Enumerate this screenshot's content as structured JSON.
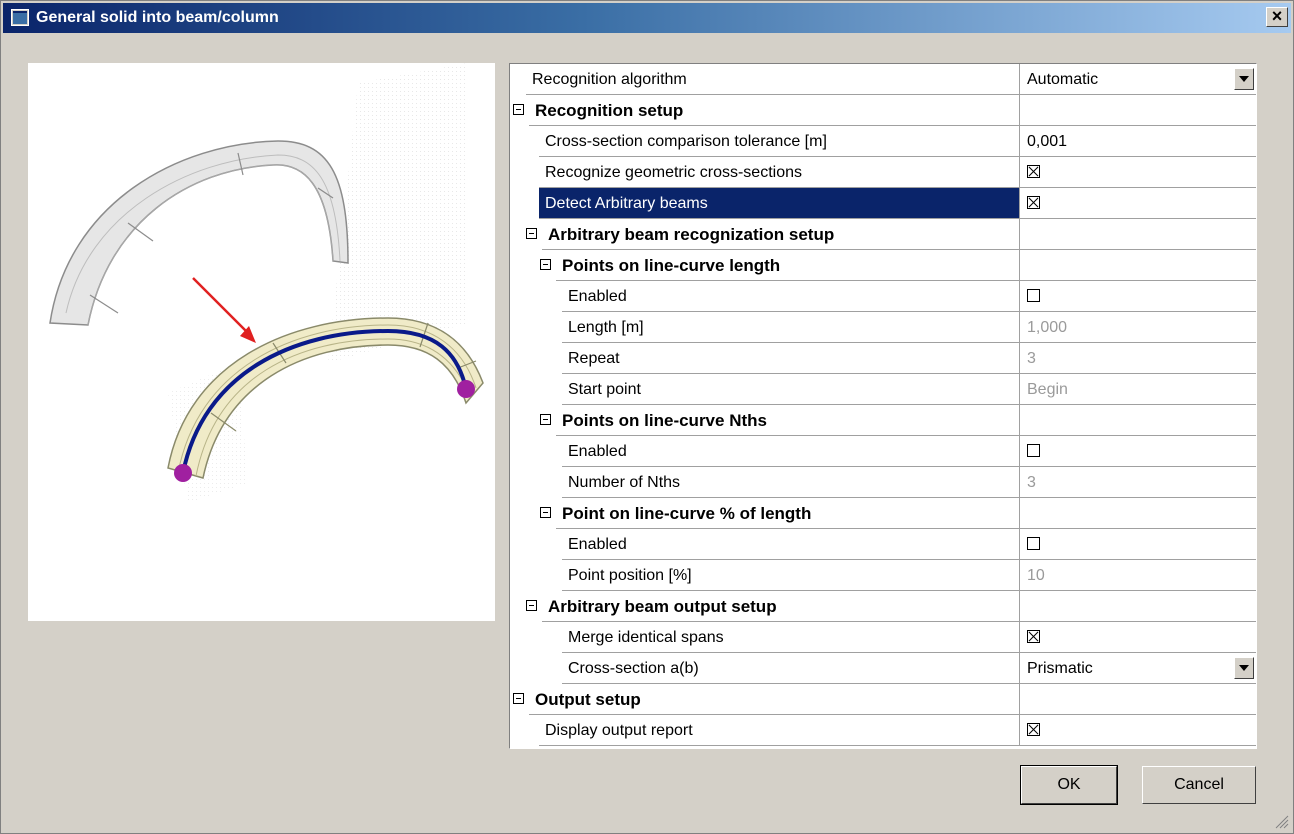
{
  "window": {
    "title": "General solid into beam/column",
    "close_label": "×"
  },
  "grid": {
    "rows": [
      {
        "name": "Recognition algorithm",
        "level": 0,
        "type": "dropdown",
        "value": "Automatic"
      },
      {
        "name": "Recognition setup",
        "level": 0,
        "type": "section"
      },
      {
        "name": "Cross-section comparison tolerance [m]",
        "level": 1,
        "type": "text",
        "value": "0,001"
      },
      {
        "name": "Recognize geometric cross-sections",
        "level": 1,
        "type": "check",
        "checked": true
      },
      {
        "name": "Detect Arbitrary beams",
        "level": 1,
        "type": "check",
        "checked": true,
        "selected": true
      },
      {
        "name": "Arbitrary beam recognization setup",
        "level": 1,
        "type": "section"
      },
      {
        "name": "Points on line-curve length",
        "level": 2,
        "type": "section"
      },
      {
        "name": "Enabled",
        "level": 3,
        "type": "check",
        "checked": false
      },
      {
        "name": "Length [m]",
        "level": 3,
        "type": "text",
        "value": "1,000",
        "disabled": true
      },
      {
        "name": "Repeat",
        "level": 3,
        "type": "text",
        "value": "3",
        "disabled": true
      },
      {
        "name": "Start point",
        "level": 3,
        "type": "text",
        "value": "Begin",
        "disabled": true
      },
      {
        "name": "Points on line-curve Nths",
        "level": 2,
        "type": "section"
      },
      {
        "name": "Enabled",
        "level": 3,
        "type": "check",
        "checked": false
      },
      {
        "name": "Number of Nths",
        "level": 3,
        "type": "text",
        "value": "3",
        "disabled": true
      },
      {
        "name": "Point on line-curve % of length",
        "level": 2,
        "type": "section"
      },
      {
        "name": "Enabled",
        "level": 3,
        "type": "check",
        "checked": false
      },
      {
        "name": "Point position [%]",
        "level": 3,
        "type": "text",
        "value": "10",
        "disabled": true
      },
      {
        "name": "Arbitrary beam output setup",
        "level": 1,
        "type": "section"
      },
      {
        "name": "Merge identical spans",
        "level": 2,
        "type": "check",
        "checked": true
      },
      {
        "name": "Cross-section a(b)",
        "level": 2,
        "type": "dropdown",
        "value": "Prismatic"
      },
      {
        "name": "Output setup",
        "level": 0,
        "type": "section"
      },
      {
        "name": "Display output report",
        "level": 1,
        "type": "check",
        "checked": true
      }
    ]
  },
  "buttons": {
    "ok": "OK",
    "cancel": "Cancel"
  },
  "colors": {
    "selection": "#0a246a",
    "beam_axis": "#0a1a8a",
    "end_points": "#a020a0",
    "arrow": "#e02020"
  }
}
